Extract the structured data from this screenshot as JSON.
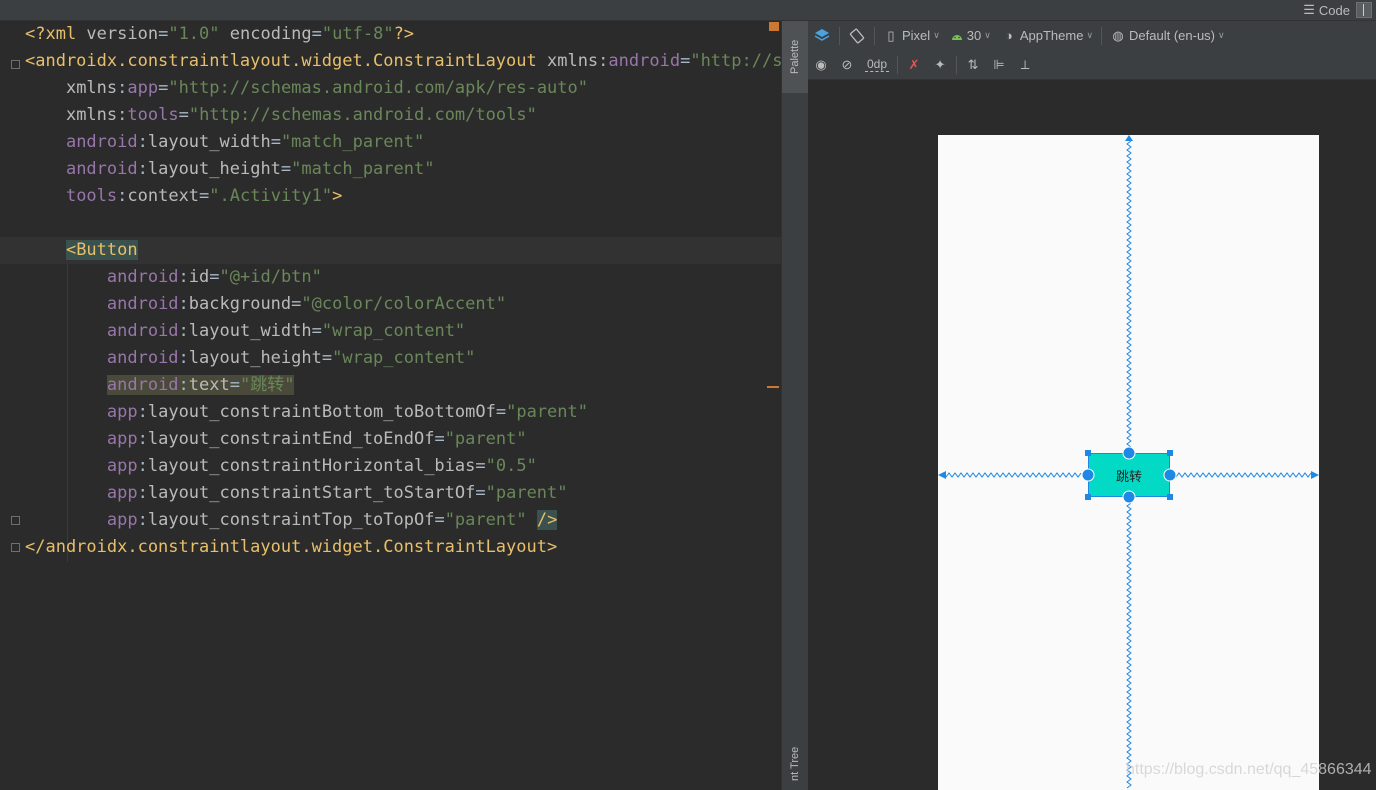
{
  "view_mode": {
    "code_label": "Code"
  },
  "editor": {
    "lines": [
      [
        {
          "c": "t-tag",
          "t": "<?xml "
        },
        {
          "c": "t-attr",
          "t": "version"
        },
        {
          "c": "t-plain",
          "t": "="
        },
        {
          "c": "t-str",
          "t": "\"1.0\""
        },
        {
          "c": "t-plain",
          "t": " "
        },
        {
          "c": "t-attr",
          "t": "encoding"
        },
        {
          "c": "t-plain",
          "t": "="
        },
        {
          "c": "t-str",
          "t": "\"utf-8\""
        },
        {
          "c": "t-tag",
          "t": "?>"
        }
      ],
      [
        {
          "c": "t-tag",
          "t": "<androidx.constraintlayout.widget.ConstraintLayout "
        },
        {
          "c": "t-attr",
          "t": "xmlns"
        },
        {
          "c": "t-plain",
          "t": ":"
        },
        {
          "c": "t-ns",
          "t": "android"
        },
        {
          "c": "t-plain",
          "t": "="
        },
        {
          "c": "t-str",
          "t": "\"http://sch"
        }
      ],
      [
        {
          "c": "t-plain",
          "t": "    "
        },
        {
          "c": "t-attr",
          "t": "xmlns"
        },
        {
          "c": "t-plain",
          "t": ":"
        },
        {
          "c": "t-ns",
          "t": "app"
        },
        {
          "c": "t-plain",
          "t": "="
        },
        {
          "c": "t-str",
          "t": "\"http://schemas.android.com/apk/res-auto\""
        }
      ],
      [
        {
          "c": "t-plain",
          "t": "    "
        },
        {
          "c": "t-attr",
          "t": "xmlns"
        },
        {
          "c": "t-plain",
          "t": ":"
        },
        {
          "c": "t-ns",
          "t": "tools"
        },
        {
          "c": "t-plain",
          "t": "="
        },
        {
          "c": "t-str",
          "t": "\"http://schemas.android.com/tools\""
        }
      ],
      [
        {
          "c": "t-plain",
          "t": "    "
        },
        {
          "c": "t-ns",
          "t": "android"
        },
        {
          "c": "t-plain",
          "t": ":"
        },
        {
          "c": "t-attr",
          "t": "layout_width"
        },
        {
          "c": "t-plain",
          "t": "="
        },
        {
          "c": "t-str",
          "t": "\"match_parent\""
        }
      ],
      [
        {
          "c": "t-plain",
          "t": "    "
        },
        {
          "c": "t-ns",
          "t": "android"
        },
        {
          "c": "t-plain",
          "t": ":"
        },
        {
          "c": "t-attr",
          "t": "layout_height"
        },
        {
          "c": "t-plain",
          "t": "="
        },
        {
          "c": "t-str",
          "t": "\"match_parent\""
        }
      ],
      [
        {
          "c": "t-plain",
          "t": "    "
        },
        {
          "c": "t-ns",
          "t": "tools"
        },
        {
          "c": "t-plain",
          "t": ":"
        },
        {
          "c": "t-attr",
          "t": "context"
        },
        {
          "c": "t-plain",
          "t": "="
        },
        {
          "c": "t-str",
          "t": "\".Activity1\""
        },
        {
          "c": "t-tag",
          "t": ">"
        }
      ],
      [],
      [
        {
          "c": "t-plain",
          "t": "    "
        },
        {
          "c": "t-tag hl-tag",
          "t": "<Button"
        }
      ],
      [
        {
          "c": "t-plain",
          "t": "        "
        },
        {
          "c": "t-ns",
          "t": "android"
        },
        {
          "c": "t-plain",
          "t": ":"
        },
        {
          "c": "t-attr",
          "t": "id"
        },
        {
          "c": "t-plain",
          "t": "="
        },
        {
          "c": "t-str",
          "t": "\"@+id/btn\""
        }
      ],
      [
        {
          "c": "t-plain",
          "t": "        "
        },
        {
          "c": "t-ns",
          "t": "android"
        },
        {
          "c": "t-plain",
          "t": ":"
        },
        {
          "c": "t-attr",
          "t": "background"
        },
        {
          "c": "t-plain",
          "t": "="
        },
        {
          "c": "t-str",
          "t": "\"@color/colorAccent\""
        }
      ],
      [
        {
          "c": "t-plain",
          "t": "        "
        },
        {
          "c": "t-ns",
          "t": "android"
        },
        {
          "c": "t-plain",
          "t": ":"
        },
        {
          "c": "t-attr",
          "t": "layout_width"
        },
        {
          "c": "t-plain",
          "t": "="
        },
        {
          "c": "t-str",
          "t": "\"wrap_content\""
        }
      ],
      [
        {
          "c": "t-plain",
          "t": "        "
        },
        {
          "c": "t-ns",
          "t": "android"
        },
        {
          "c": "t-plain",
          "t": ":"
        },
        {
          "c": "t-attr",
          "t": "layout_height"
        },
        {
          "c": "t-plain",
          "t": "="
        },
        {
          "c": "t-str",
          "t": "\"wrap_content\""
        }
      ],
      [
        {
          "c": "t-plain",
          "t": "        "
        },
        {
          "c": "t-ns hl-warn",
          "t": "android"
        },
        {
          "c": "t-plain hl-warn",
          "t": ":"
        },
        {
          "c": "t-attr hl-warn",
          "t": "text"
        },
        {
          "c": "t-plain hl-warn",
          "t": "="
        },
        {
          "c": "t-str hl-warn",
          "t": "\"跳转\""
        }
      ],
      [
        {
          "c": "t-plain",
          "t": "        "
        },
        {
          "c": "t-ns",
          "t": "app"
        },
        {
          "c": "t-plain",
          "t": ":"
        },
        {
          "c": "t-attr",
          "t": "layout_constraintBottom_toBottomOf"
        },
        {
          "c": "t-plain",
          "t": "="
        },
        {
          "c": "t-str",
          "t": "\"parent\""
        }
      ],
      [
        {
          "c": "t-plain",
          "t": "        "
        },
        {
          "c": "t-ns",
          "t": "app"
        },
        {
          "c": "t-plain",
          "t": ":"
        },
        {
          "c": "t-attr",
          "t": "layout_constraintEnd_toEndOf"
        },
        {
          "c": "t-plain",
          "t": "="
        },
        {
          "c": "t-str",
          "t": "\"parent\""
        }
      ],
      [
        {
          "c": "t-plain",
          "t": "        "
        },
        {
          "c": "t-ns",
          "t": "app"
        },
        {
          "c": "t-plain",
          "t": ":"
        },
        {
          "c": "t-attr",
          "t": "layout_constraintHorizontal_bias"
        },
        {
          "c": "t-plain",
          "t": "="
        },
        {
          "c": "t-str",
          "t": "\"0.5\""
        }
      ],
      [
        {
          "c": "t-plain",
          "t": "        "
        },
        {
          "c": "t-ns",
          "t": "app"
        },
        {
          "c": "t-plain",
          "t": ":"
        },
        {
          "c": "t-attr",
          "t": "layout_constraintStart_toStartOf"
        },
        {
          "c": "t-plain",
          "t": "="
        },
        {
          "c": "t-str",
          "t": "\"parent\""
        }
      ],
      [
        {
          "c": "t-plain",
          "t": "        "
        },
        {
          "c": "t-ns",
          "t": "app"
        },
        {
          "c": "t-plain",
          "t": ":"
        },
        {
          "c": "t-attr",
          "t": "layout_constraintTop_toTopOf"
        },
        {
          "c": "t-plain",
          "t": "="
        },
        {
          "c": "t-str",
          "t": "\"parent\""
        },
        {
          "c": "t-plain",
          "t": " "
        },
        {
          "c": "t-tag hl-tag",
          "t": "/>"
        }
      ],
      [
        {
          "c": "t-tag",
          "t": "</androidx.constraintlayout.widget.ConstraintLayout>"
        }
      ]
    ]
  },
  "side_tabs": {
    "palette": "Palette",
    "component_tree": "nt Tree"
  },
  "toolbar": {
    "device": "Pixel",
    "api": "30",
    "theme": "AppTheme",
    "locale": "Default (en-us)",
    "margin": "0dp"
  },
  "preview": {
    "button_text": "跳转"
  },
  "colors": {
    "accent": "#03dac5",
    "constraint": "#1e88e5",
    "warning": "#cc7832"
  },
  "watermark": "https://blog.csdn.net/qq_45866344"
}
